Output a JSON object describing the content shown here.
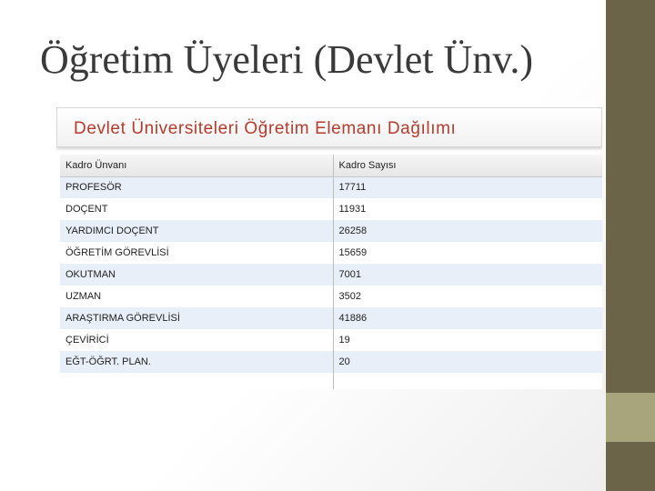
{
  "slide": {
    "title": "Öğretim Üyeleri (Devlet Ünv.)"
  },
  "panel": {
    "title": "Devlet Üniversiteleri Öğretim Elemanı Dağılımı"
  },
  "table": {
    "headers": [
      "Kadro Ünvanı",
      "Kadro Sayısı"
    ],
    "rows": [
      [
        "PROFESÖR",
        "17711"
      ],
      [
        "DOÇENT",
        "11931"
      ],
      [
        "YARDIMCI DOÇENT",
        "26258"
      ],
      [
        "ÖĞRETİM GÖREVLİSİ",
        "15659"
      ],
      [
        "OKUTMAN",
        "7001"
      ],
      [
        "UZMAN",
        "3502"
      ],
      [
        "ARAŞTIRMA GÖREVLİSİ",
        "41886"
      ],
      [
        "ÇEVİRİCİ",
        "19"
      ],
      [
        "EĞT-ÖĞRT. PLAN.",
        "20"
      ]
    ]
  },
  "colors": {
    "panel_title": "#b73b2c",
    "accent_dark": "#6b6448",
    "accent_light": "#a8a57c",
    "row_stripe": "#e9eff8"
  }
}
